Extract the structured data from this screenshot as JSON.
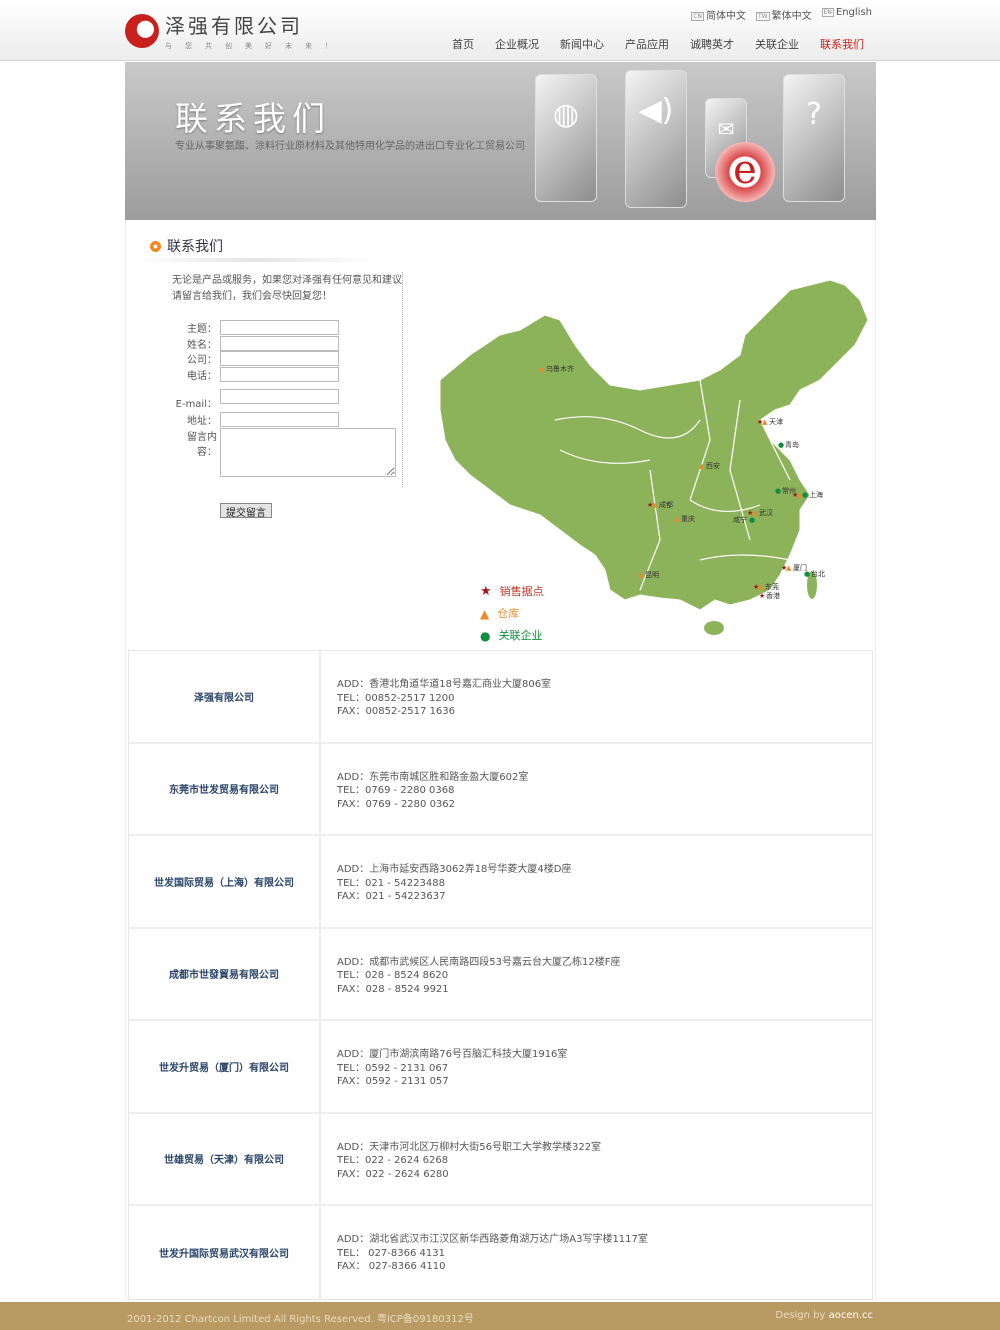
{
  "header": {
    "logo_name": "泽强有限公司",
    "logo_slogan": "与您共创美好未来！",
    "languages": [
      {
        "icon": "CN",
        "label": "简体中文"
      },
      {
        "icon": "TW",
        "label": "繁体中文"
      },
      {
        "icon": "EN",
        "label": "English"
      }
    ],
    "nav": [
      "首页",
      "企业概况",
      "新闻中心",
      "产品应用",
      "诚聘英才",
      "关联企业",
      "联系我们"
    ],
    "active_nav": "联系我们"
  },
  "banner": {
    "title": "联系我们",
    "subtitle": "专业从事聚氨酯、涂料行业原材料及其他特用化学品的进出口专业化工贸易公司",
    "card_icons": [
      "globe-icon",
      "speaker-icon",
      "mail-icon",
      "question-icon"
    ],
    "logo_letter": "e"
  },
  "section": {
    "title": "联系我们"
  },
  "form": {
    "intro": "无论是产品或服务，如果您对泽强有任何意见和建议请留言给我们，我们会尽快回复您！",
    "fields": [
      "主题：",
      "姓名：",
      "公司：",
      "电话：",
      "E-mail：",
      "地址："
    ],
    "message_label": "留言内容：",
    "submit": "提交留言"
  },
  "map": {
    "cities": [
      "乌鲁木齐",
      "天津",
      "青岛",
      "西安",
      "常州",
      "上海",
      "成都",
      "重庆",
      "武汉",
      "咸宁",
      "厦门",
      "台北",
      "昆明",
      "东莞",
      "香港"
    ],
    "legend": [
      {
        "label": "销售据点",
        "color": "#9b1c1c",
        "shape": "star"
      },
      {
        "label": "仓库",
        "color": "#e98a2b",
        "shape": "triangle"
      },
      {
        "label": "关联企业",
        "color": "#0e8f3c",
        "shape": "circle"
      }
    ],
    "land_color": "#8db35a"
  },
  "companies": [
    {
      "name": "泽强有限公司",
      "add": "ADD：香港北角道华道18号嘉汇商业大厦806室",
      "tel": "TEL：00852-2517 1200",
      "fax": "FAX：00852-2517 1636"
    },
    {
      "name": "东莞市世发贸易有限公司",
      "add": "ADD：东莞市南城区胜和路金盈大厦602室",
      "tel": "TEL：0769 - 2280 0368",
      "fax": "FAX：0769 - 2280 0362"
    },
    {
      "name": "世发国际贸易（上海）有限公司",
      "add": "ADD：上海市延安西路3062弄18号华菱大厦4楼D座",
      "tel": "TEL：021 - 54223488",
      "fax": "FAX：021 - 54223637"
    },
    {
      "name": "成都市世發貿易有限公司",
      "add": "ADD：成都市武候区人民南路四段53号嘉云台大厦乙栋12楼F座",
      "tel": "TEL：028 - 8524 8620",
      "fax": "FAX：028 - 8524 9921"
    },
    {
      "name": "世发升贸易（厦门）有限公司",
      "add": "ADD：厦门市湖滨南路76号百脑汇科技大厦1916室",
      "tel": "TEL：0592 - 2131 067",
      "fax": "FAX：0592 - 2131 057"
    },
    {
      "name": "世雄贸易（天津）有限公司",
      "add": "ADD：天津市河北区万柳村大街56号职工大学教学楼322室",
      "tel": "TEL：022 - 2624 6268",
      "fax": "FAX：022 - 2624 6280"
    },
    {
      "name": "世发升国际贸易武汉有限公司",
      "add": "ADD：湖北省武汉市江汉区新华西路菱角湖万达广场A3写字楼1117室",
      "tel": "TEL： 027-8366 4131",
      "fax": "FAX： 027-8366 4110"
    }
  ],
  "footer": {
    "copyright": "2001-2012 Chartcon Limited All Rights Reserved. 粤ICP备09180312号",
    "design_prefix": "Design by ",
    "design_link": "aocen.cc"
  }
}
